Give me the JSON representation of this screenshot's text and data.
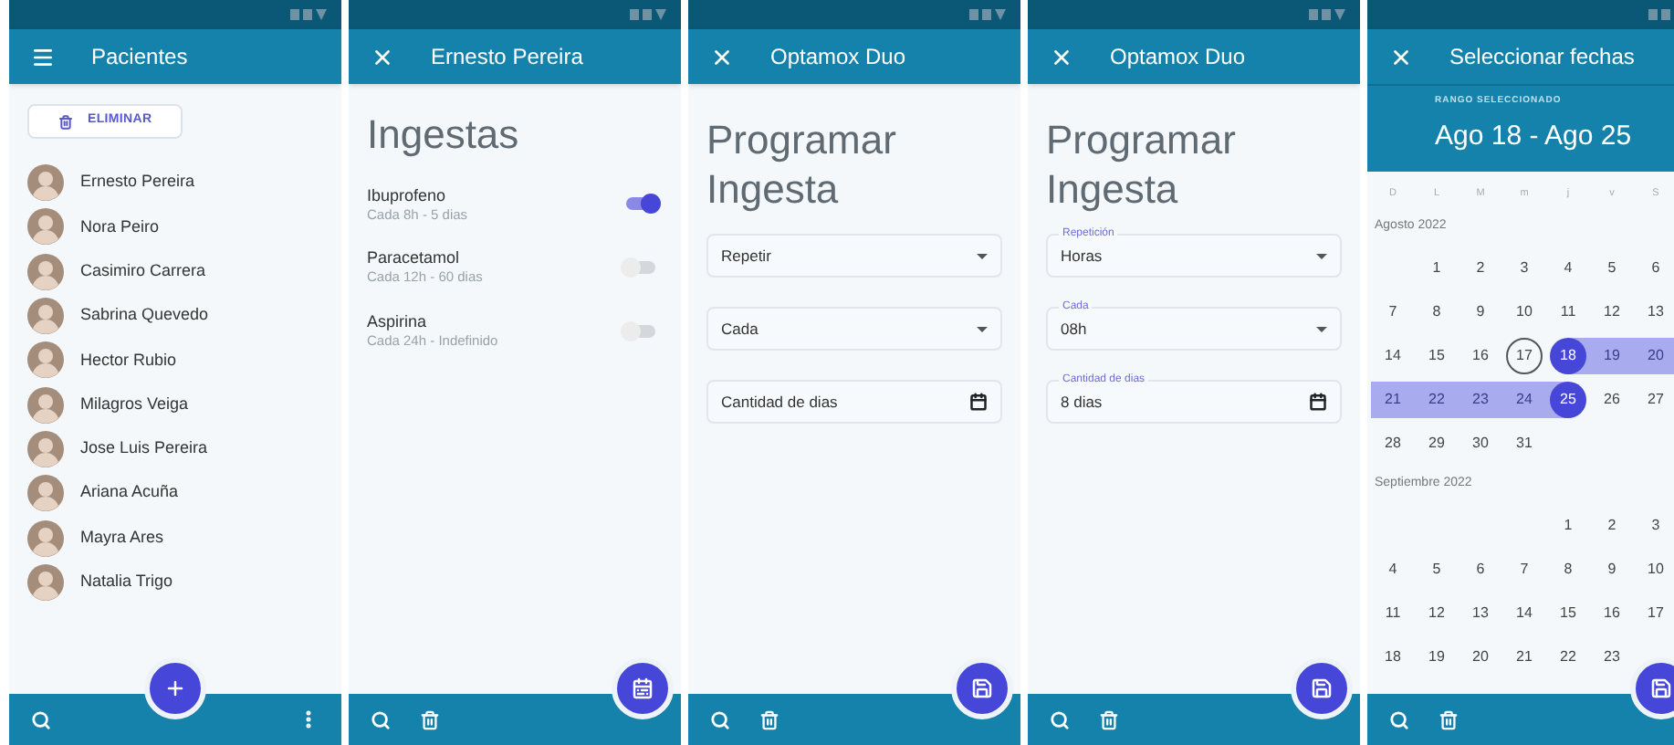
{
  "screens": [
    {
      "kind": "patients",
      "title": "Pacientes",
      "delete_button": "ELIMINAR",
      "patients": [
        "Ernesto Pereira",
        "Nora Peiro",
        "Casimiro Carrera",
        "Sabrina Quevedo",
        "Hector Rubio",
        "Milagros Veiga",
        "Jose Luis Pereira",
        "Ariana Acuña",
        "Mayra Ares",
        "Natalia Trigo"
      ]
    },
    {
      "kind": "intakes",
      "title": "Ernesto Pereira",
      "heading": "Ingestas",
      "items": [
        {
          "name": "Ibuprofeno",
          "detail": "Cada 8h - 5 dias",
          "on": true
        },
        {
          "name": "Paracetamol",
          "detail": "Cada 12h - 60 dias",
          "on": false
        },
        {
          "name": "Aspirina",
          "detail": "Cada 24h - Indefinido",
          "on": false
        }
      ]
    },
    {
      "kind": "schedule",
      "title": "Optamox Duo",
      "heading": "Programar Ingesta",
      "fields": [
        {
          "kind": "select",
          "label": "Repetir"
        },
        {
          "kind": "select",
          "label": "Cada"
        },
        {
          "kind": "date",
          "label": "Cantidad de dias"
        }
      ]
    },
    {
      "kind": "schedule",
      "title": "Optamox Duo",
      "heading": "Programar Ingesta",
      "fields": [
        {
          "kind": "select",
          "label": "Repetición",
          "value": "Horas"
        },
        {
          "kind": "select",
          "label": "Cada",
          "value": "08h"
        },
        {
          "kind": "date",
          "label": "Cantidad de dias",
          "value": "8 dias"
        }
      ]
    },
    {
      "kind": "calendar",
      "title": "Seleccionar fechas",
      "range_caption": "RANGO SELECCIONADO",
      "range": "Ago 18 - Ago 25",
      "weekdays": [
        "D",
        "L",
        "M",
        "m",
        "j",
        "v",
        "S"
      ],
      "months": [
        {
          "title": "Agosto 2022",
          "weeks": [
            {
              "kind": "leading",
              "days": [
                {
                  "day": "1",
                  "selected": false,
                  "in_range": false,
                  "today": false
                },
                {
                  "day": "2",
                  "selected": false,
                  "in_range": false,
                  "today": false
                },
                {
                  "day": "3",
                  "selected": false,
                  "in_range": false,
                  "today": false
                },
                {
                  "day": "4",
                  "selected": false,
                  "in_range": false,
                  "today": false
                },
                {
                  "day": "5",
                  "selected": false,
                  "in_range": false,
                  "today": false
                },
                {
                  "day": "6",
                  "selected": false,
                  "in_range": false,
                  "today": false
                }
              ]
            },
            {
              "kind": "regular",
              "days": [
                {
                  "day": "7",
                  "selected": false,
                  "in_range": false,
                  "today": false
                },
                {
                  "day": "8",
                  "selected": false,
                  "in_range": false,
                  "today": false
                },
                {
                  "day": "9",
                  "selected": false,
                  "in_range": false,
                  "today": false
                },
                {
                  "day": "10",
                  "selected": false,
                  "in_range": false,
                  "today": false
                },
                {
                  "day": "11",
                  "selected": false,
                  "in_range": false,
                  "today": false
                },
                {
                  "day": "12",
                  "selected": false,
                  "in_range": false,
                  "today": false
                },
                {
                  "day": "13",
                  "selected": false,
                  "in_range": false,
                  "today": false
                }
              ]
            },
            {
              "kind": "regular",
              "days": [
                {
                  "day": "14",
                  "selected": false,
                  "in_range": false,
                  "today": false
                },
                {
                  "day": "15",
                  "selected": false,
                  "in_range": false,
                  "today": false
                },
                {
                  "day": "16",
                  "selected": false,
                  "in_range": false,
                  "today": false
                },
                {
                  "day": "17",
                  "selected": false,
                  "in_range": false,
                  "today": true
                },
                {
                  "day": "18",
                  "selected": true,
                  "in_range": true,
                  "today": false
                },
                {
                  "day": "19",
                  "selected": false,
                  "in_range": true,
                  "today": false
                },
                {
                  "day": "20",
                  "selected": false,
                  "in_range": true,
                  "today": false
                }
              ]
            },
            {
              "kind": "regular",
              "days": [
                {
                  "day": "21",
                  "selected": false,
                  "in_range": true,
                  "today": false
                },
                {
                  "day": "22",
                  "selected": false,
                  "in_range": true,
                  "today": false
                },
                {
                  "day": "23",
                  "selected": false,
                  "in_range": true,
                  "today": false
                },
                {
                  "day": "24",
                  "selected": false,
                  "in_range": true,
                  "today": false
                },
                {
                  "day": "25",
                  "selected": true,
                  "in_range": true,
                  "today": false
                },
                {
                  "day": "26",
                  "selected": false,
                  "in_range": false,
                  "today": false
                },
                {
                  "day": "27",
                  "selected": false,
                  "in_range": false,
                  "today": false
                }
              ]
            },
            {
              "kind": "regular",
              "days": [
                {
                  "day": "28",
                  "selected": false,
                  "in_range": false,
                  "today": false
                },
                {
                  "day": "29",
                  "selected": false,
                  "in_range": false,
                  "today": false
                },
                {
                  "day": "30",
                  "selected": false,
                  "in_range": false,
                  "today": false
                },
                {
                  "day": "31",
                  "selected": false,
                  "in_range": false,
                  "today": false
                }
              ]
            }
          ]
        },
        {
          "title": "Septiembre 2022",
          "weeks": [
            {
              "kind": "leading",
              "days": [
                {
                  "day": "1",
                  "selected": false,
                  "in_range": false,
                  "today": false
                },
                {
                  "day": "2",
                  "selected": false,
                  "in_range": false,
                  "today": false
                },
                {
                  "day": "3",
                  "selected": false,
                  "in_range": false,
                  "today": false
                }
              ]
            },
            {
              "kind": "regular",
              "days": [
                {
                  "day": "4",
                  "selected": false,
                  "in_range": false,
                  "today": false
                },
                {
                  "day": "5",
                  "selected": false,
                  "in_range": false,
                  "today": false
                },
                {
                  "day": "6",
                  "selected": false,
                  "in_range": false,
                  "today": false
                },
                {
                  "day": "7",
                  "selected": false,
                  "in_range": false,
                  "today": false
                },
                {
                  "day": "8",
                  "selected": false,
                  "in_range": false,
                  "today": false
                },
                {
                  "day": "9",
                  "selected": false,
                  "in_range": false,
                  "today": false
                },
                {
                  "day": "10",
                  "selected": false,
                  "in_range": false,
                  "today": false
                }
              ]
            },
            {
              "kind": "regular",
              "days": [
                {
                  "day": "11",
                  "selected": false,
                  "in_range": false,
                  "today": false
                },
                {
                  "day": "12",
                  "selected": false,
                  "in_range": false,
                  "today": false
                },
                {
                  "day": "13",
                  "selected": false,
                  "in_range": false,
                  "today": false
                },
                {
                  "day": "14",
                  "selected": false,
                  "in_range": false,
                  "today": false
                },
                {
                  "day": "15",
                  "selected": false,
                  "in_range": false,
                  "today": false
                },
                {
                  "day": "16",
                  "selected": false,
                  "in_range": false,
                  "today": false
                },
                {
                  "day": "17",
                  "selected": false,
                  "in_range": false,
                  "today": false
                }
              ]
            },
            {
              "kind": "regular",
              "days": [
                {
                  "day": "18",
                  "selected": false,
                  "in_range": false,
                  "today": false
                },
                {
                  "day": "19",
                  "selected": false,
                  "in_range": false,
                  "today": false
                },
                {
                  "day": "20",
                  "selected": false,
                  "in_range": false,
                  "today": false
                },
                {
                  "day": "21",
                  "selected": false,
                  "in_range": false,
                  "today": false
                },
                {
                  "day": "22",
                  "selected": false,
                  "in_range": false,
                  "today": false
                },
                {
                  "day": "23",
                  "selected": false,
                  "in_range": false,
                  "today": false
                }
              ]
            }
          ]
        }
      ]
    }
  ]
}
